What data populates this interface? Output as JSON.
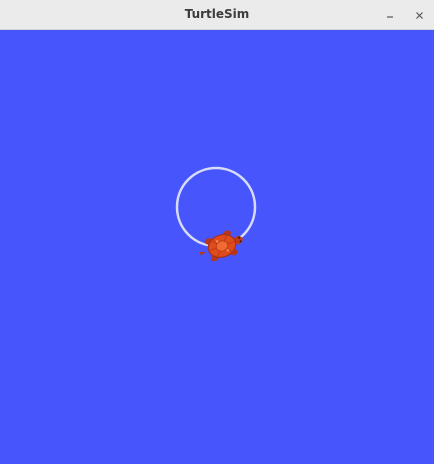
{
  "window": {
    "title": "TurtleSim"
  },
  "titlebar_buttons": {
    "minimize_icon": "minimize-icon",
    "close_icon": "close-icon"
  },
  "canvas": {
    "background_color": "#4656fc",
    "pen_color": "#d8dcf8",
    "turtle_icon": "turtle-icon",
    "turtle_shell_color": "#e04b1c",
    "turtle_body_color": "#c23a15"
  }
}
